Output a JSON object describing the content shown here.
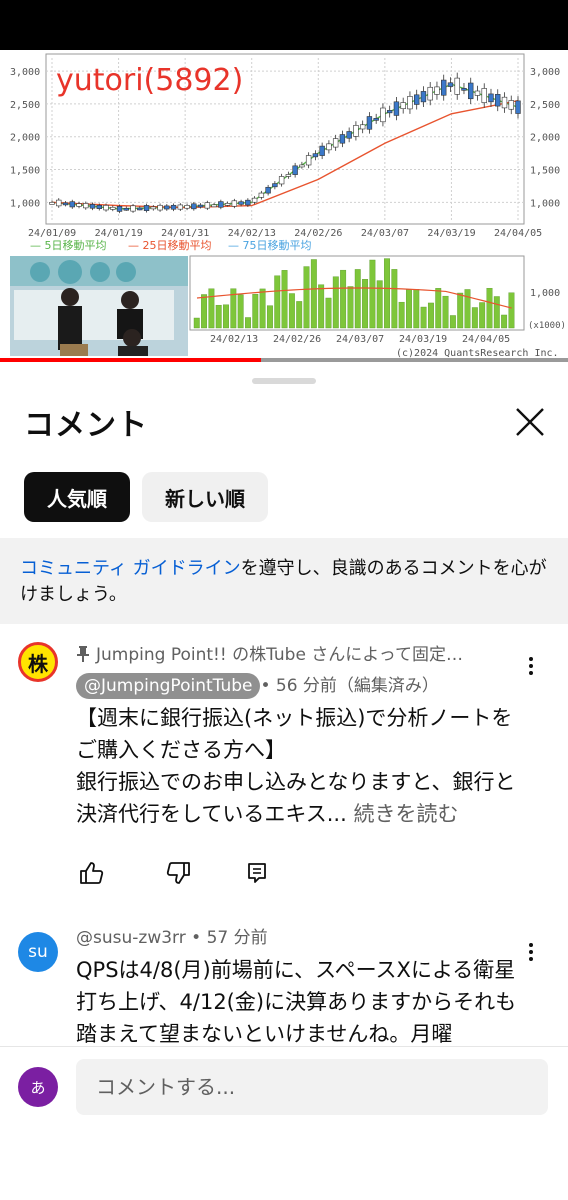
{
  "video": {
    "chart_title": "yutori(5892)",
    "price_ticks": [
      "3,000",
      "2,500",
      "2,000",
      "1,500",
      "1,000"
    ],
    "volume_tick": "1,000",
    "volume_unit": "(x1000)",
    "date_ticks": [
      "24/01/09",
      "24/01/19",
      "24/01/31",
      "24/02/13",
      "24/02/26",
      "24/03/07",
      "24/03/19",
      "24/04/05"
    ],
    "volume_date_ticks": [
      "24/02/13",
      "24/02/26",
      "24/03/07",
      "24/03/19",
      "24/04/05"
    ],
    "legend": [
      "5日移動平均",
      "25日移動平均",
      "75日移動平均"
    ],
    "copyright": "(c)2024 QuantsResearch Inc.",
    "progress": 0.46
  },
  "sheet": {
    "title": "コメント",
    "chips": [
      "人気順",
      "新しい順"
    ],
    "guideline_link": "コミュニティ ガイドライン",
    "guideline_rest": "を遵守し、良識のあるコメントを心がけましょう。"
  },
  "comments": [
    {
      "pin_text": "Jumping Point!! の株Tube さんによって固定…",
      "avatar_text": "株",
      "handle": "@JumpingPointTube",
      "meta": "• 56 分前（編集済み）",
      "text": "【週末に銀行振込(ネット振込)で分析ノートをご購入くださる方へ】\n銀行振込でのお申し込みとなりますと、銀行と決済代行をしているエキス...",
      "read_more": "続きを読む"
    },
    {
      "avatar_text": "su",
      "handle": "@susu-zw3rr",
      "meta": " • 57 分前",
      "text": "QPSは4/8(月)前場前に、スペースXによる衛星打ち上げ、4/12(金)に決算ありますからそれも踏まえて望まないといけませんね。月曜"
    }
  ],
  "composer": {
    "avatar_text": "あ",
    "placeholder": "コメントする..."
  },
  "colors": {
    "accent_link": "#065fd4",
    "progress": "#ff0000",
    "chip_active": "#0f0f0f",
    "composer_avatar": "#7b1fa2",
    "candle_up": "#ffffff",
    "candle_down": "#3a78c9",
    "ma5": "#58b44a",
    "ma25": "#e8542f",
    "ma75": "#4aa3e0",
    "volume_bar": "#7ec63a"
  },
  "chart_data": {
    "type": "line",
    "title": "yutori(5892)",
    "x": [
      "24/01/09",
      "24/01/19",
      "24/01/31",
      "24/02/13",
      "24/02/26",
      "24/03/07",
      "24/03/19",
      "24/04/05"
    ],
    "series": [
      {
        "name": "5日移動平均",
        "values": [
          1000,
          900,
          930,
          1000,
          1750,
          2350,
          2800,
          2450
        ]
      },
      {
        "name": "25日移動平均",
        "values": [
          1000,
          950,
          920,
          950,
          1350,
          1900,
          2350,
          2550
        ]
      }
    ],
    "ylim": [
      700,
      3200
    ],
    "grid": true,
    "legend": "bottom"
  }
}
